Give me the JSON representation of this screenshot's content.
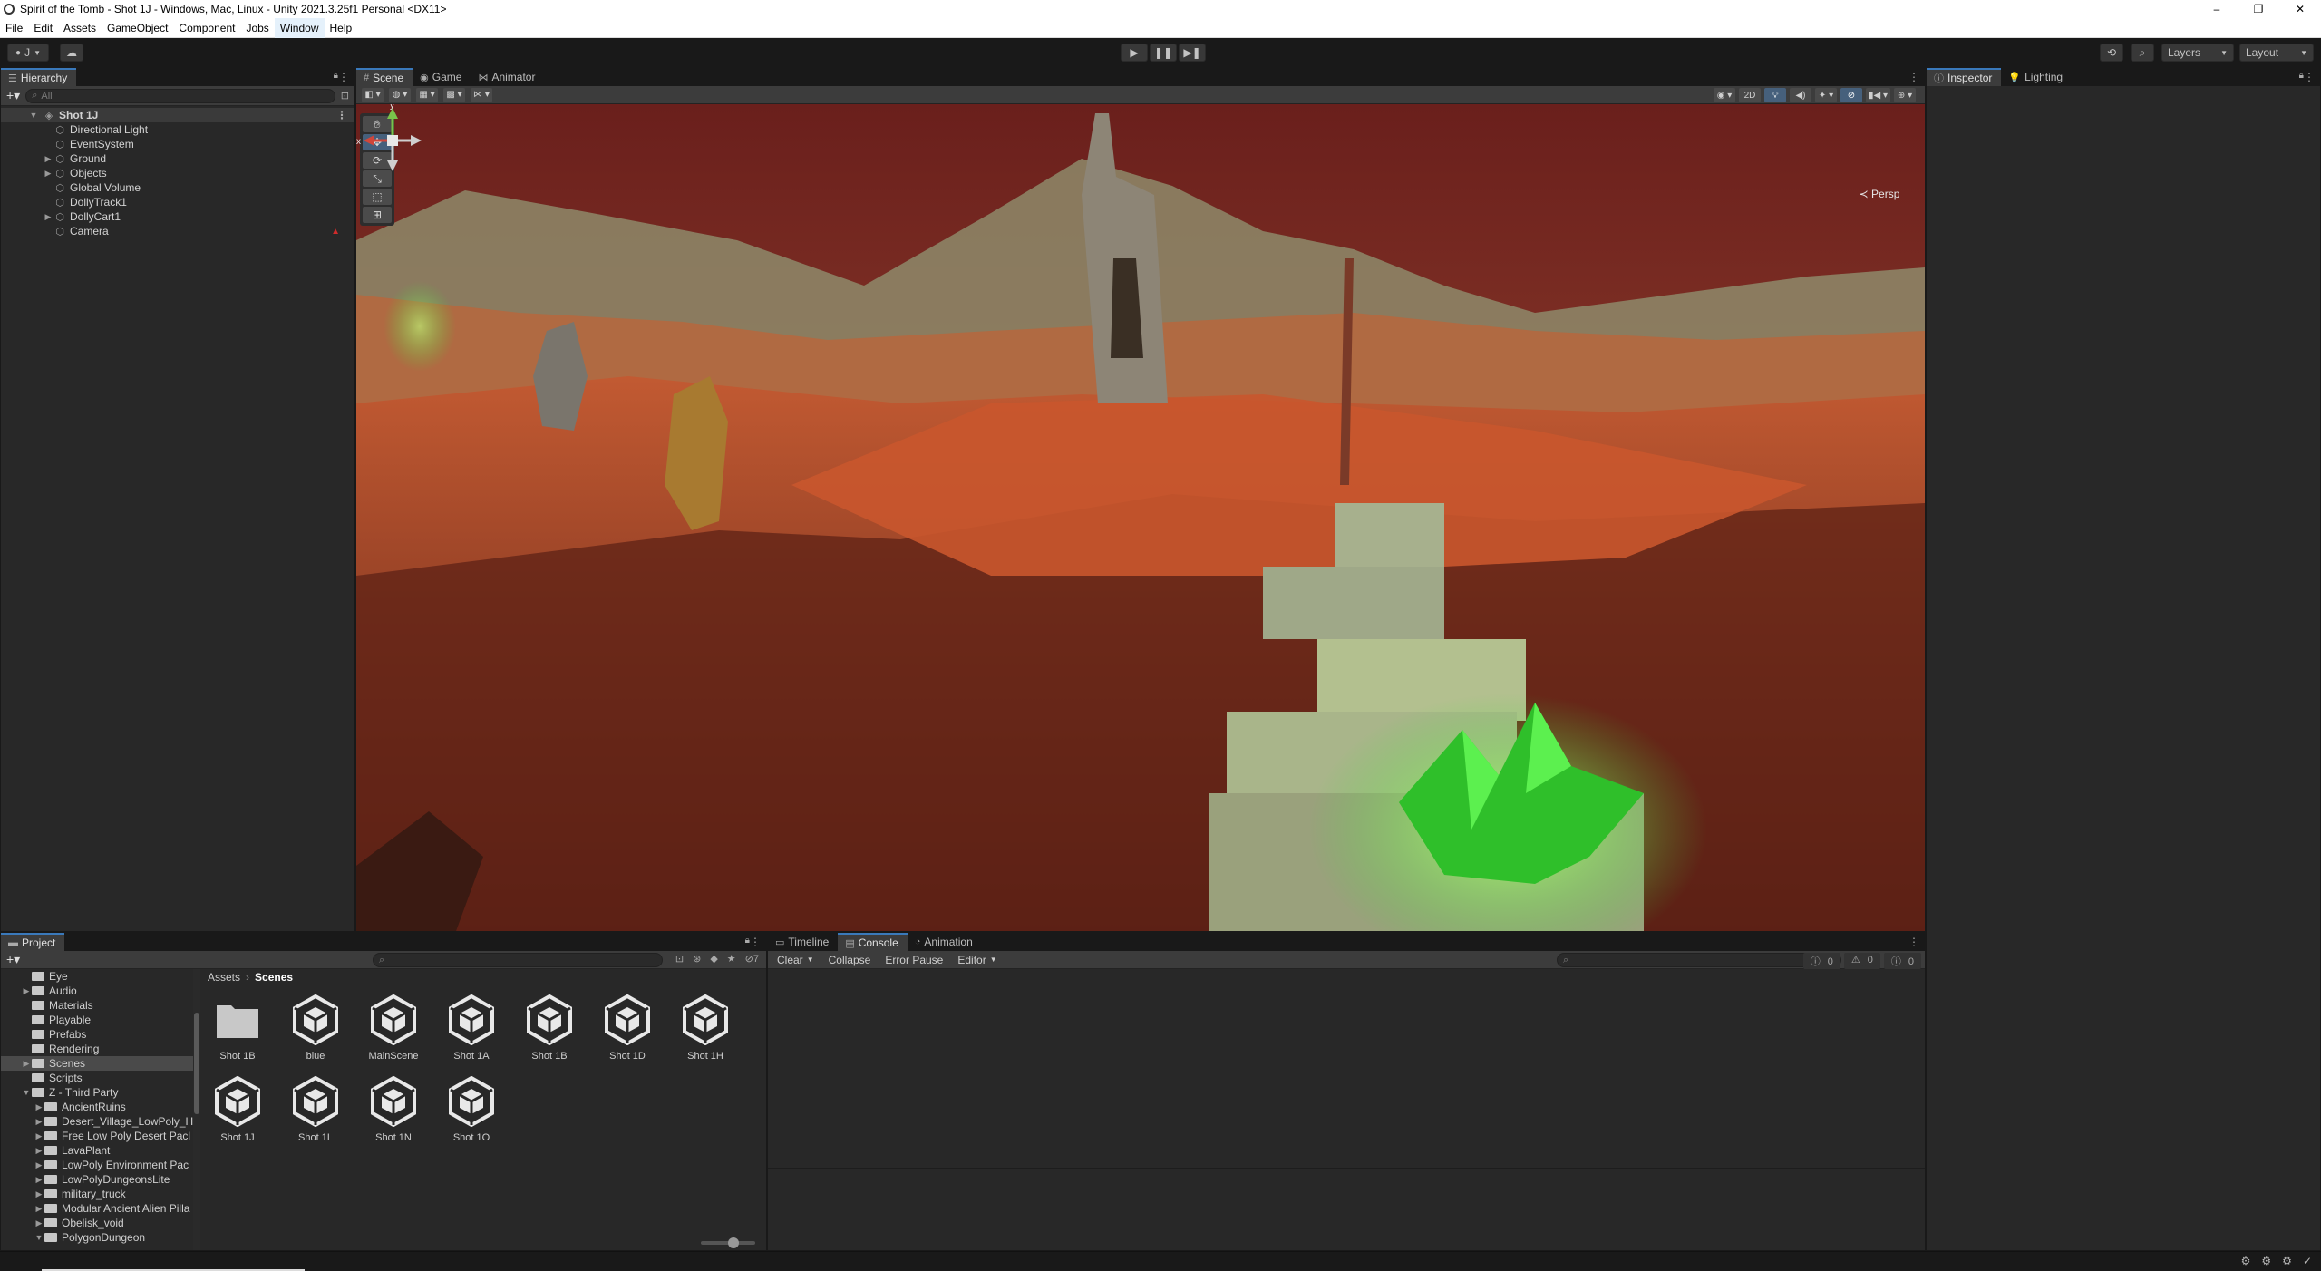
{
  "window": {
    "title": "Spirit of the Tomb - Shot 1J - Windows, Mac, Linux - Unity 2021.3.25f1 Personal <DX11>",
    "controls": [
      "–",
      "❐",
      "✕"
    ]
  },
  "menu": [
    "File",
    "Edit",
    "Assets",
    "GameObject",
    "Component",
    "Jobs",
    "Window",
    "Help"
  ],
  "toolbar": {
    "account_label": "J",
    "layers_label": "Layers",
    "layout_label": "Layout"
  },
  "hierarchy": {
    "tab_label": "Hierarchy",
    "search_placeholder": "All",
    "scene_name": "Shot 1J",
    "items": [
      {
        "label": "Directional Light",
        "expandable": false
      },
      {
        "label": "EventSystem",
        "expandable": false
      },
      {
        "label": "Ground",
        "expandable": true
      },
      {
        "label": "Objects",
        "expandable": true
      },
      {
        "label": "Global Volume",
        "expandable": false
      },
      {
        "label": "DollyTrack1",
        "expandable": false
      },
      {
        "label": "DollyCart1",
        "expandable": true
      },
      {
        "label": "Camera",
        "expandable": false
      }
    ]
  },
  "scene_tabs": [
    {
      "label": "Scene",
      "icon": "#",
      "active": true
    },
    {
      "label": "Game",
      "icon": "◉",
      "active": false
    },
    {
      "label": "Animator",
      "icon": "⋈",
      "active": false
    }
  ],
  "scene_view": {
    "toggle_2d": "2D",
    "persp_label": "Persp",
    "gizmo_labels": {
      "y": "y",
      "x": "x"
    }
  },
  "inspector_tabs": [
    {
      "label": "Inspector",
      "icon": "ⓘ",
      "active": true
    },
    {
      "label": "Lighting",
      "icon": "💡",
      "active": false
    }
  ],
  "project": {
    "tab_label": "Project",
    "breadcrumb": [
      "Assets",
      "Scenes"
    ],
    "hidden_count": "7",
    "tree": [
      {
        "label": "Eye",
        "indent": 1,
        "arrow": ""
      },
      {
        "label": "Audio",
        "indent": 1,
        "arrow": "▶"
      },
      {
        "label": "Materials",
        "indent": 1,
        "arrow": ""
      },
      {
        "label": "Playable",
        "indent": 1,
        "arrow": ""
      },
      {
        "label": "Prefabs",
        "indent": 1,
        "arrow": ""
      },
      {
        "label": "Rendering",
        "indent": 1,
        "arrow": ""
      },
      {
        "label": "Scenes",
        "indent": 1,
        "arrow": "▶",
        "selected": true
      },
      {
        "label": "Scripts",
        "indent": 1,
        "arrow": ""
      },
      {
        "label": "Z - Third Party",
        "indent": 1,
        "arrow": "▼"
      },
      {
        "label": "AncientRuins",
        "indent": 2,
        "arrow": "▶"
      },
      {
        "label": "Desert_Village_LowPoly_H",
        "indent": 2,
        "arrow": "▶"
      },
      {
        "label": "Free Low Poly Desert Pacl",
        "indent": 2,
        "arrow": "▶"
      },
      {
        "label": "LavaPlant",
        "indent": 2,
        "arrow": "▶"
      },
      {
        "label": "LowPoly Environment Pac",
        "indent": 2,
        "arrow": "▶"
      },
      {
        "label": "LowPolyDungeonsLite",
        "indent": 2,
        "arrow": "▶"
      },
      {
        "label": "military_truck",
        "indent": 2,
        "arrow": "▶"
      },
      {
        "label": "Modular Ancient Alien Pilla",
        "indent": 2,
        "arrow": "▶"
      },
      {
        "label": "Obelisk_void",
        "indent": 2,
        "arrow": "▶"
      },
      {
        "label": "PolygonDungeon",
        "indent": 2,
        "arrow": "▼"
      }
    ],
    "assets": [
      {
        "label": "Shot 1B",
        "kind": "folder"
      },
      {
        "label": "blue",
        "kind": "scene"
      },
      {
        "label": "MainScene",
        "kind": "scene"
      },
      {
        "label": "Shot 1A",
        "kind": "scene"
      },
      {
        "label": "Shot 1B",
        "kind": "scene"
      },
      {
        "label": "Shot 1D",
        "kind": "scene"
      },
      {
        "label": "Shot 1H",
        "kind": "scene"
      },
      {
        "label": "Shot 1J",
        "kind": "scene"
      },
      {
        "label": "Shot 1L",
        "kind": "scene"
      },
      {
        "label": "Shot 1N",
        "kind": "scene"
      },
      {
        "label": "Shot 1O",
        "kind": "scene"
      }
    ]
  },
  "console": {
    "tabs": [
      {
        "label": "Timeline",
        "icon": "▭",
        "active": false
      },
      {
        "label": "Console",
        "icon": "▤",
        "active": true
      },
      {
        "label": "Animation",
        "icon": "◔",
        "active": false
      }
    ],
    "buttons": {
      "clear": "Clear",
      "collapse": "Collapse",
      "error_pause": "Error Pause",
      "editor": "Editor"
    },
    "counts": {
      "info": "0",
      "warnings": "0",
      "errors": "0"
    }
  },
  "colors": {
    "accent": "#3a79bb",
    "panel_bg": "#282828",
    "toolbar_bg": "#3c3c3c",
    "selection": "#2c5d87",
    "sky": "#7a2a22",
    "ground": "#b5482a",
    "crystal": "#3fdc3a"
  }
}
